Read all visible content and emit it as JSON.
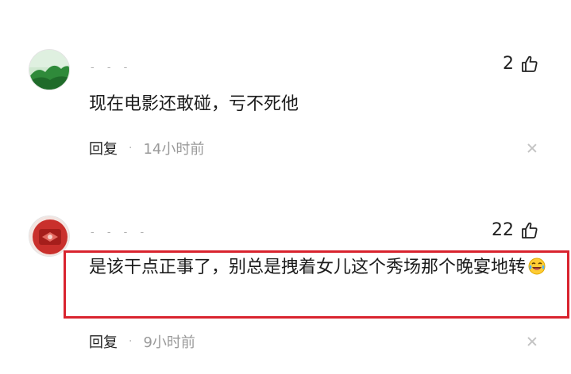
{
  "comments": [
    {
      "username": "- - -",
      "likes": "2",
      "text": "现在电影还敢碰，亏不死他",
      "reply_label": "回复",
      "separator": "·",
      "time": "14小时前",
      "avatar_icon": "landscape-avatar-icon"
    },
    {
      "username": "- - - -",
      "likes": "22",
      "text": "是该干点正事了，别总是拽着女儿这个秀场那个晚宴地转",
      "reply_label": "回复",
      "separator": "·",
      "time": "9小时前",
      "avatar_icon": "red-emblem-avatar-icon",
      "highlighted": true
    }
  ],
  "icons": {
    "like": "thumbs-up-icon",
    "close": "close-icon",
    "emoji": "laughing-crying-emoji-icon"
  },
  "colors": {
    "highlight_border": "#d9232e",
    "meta_text": "#9a9a9a"
  }
}
